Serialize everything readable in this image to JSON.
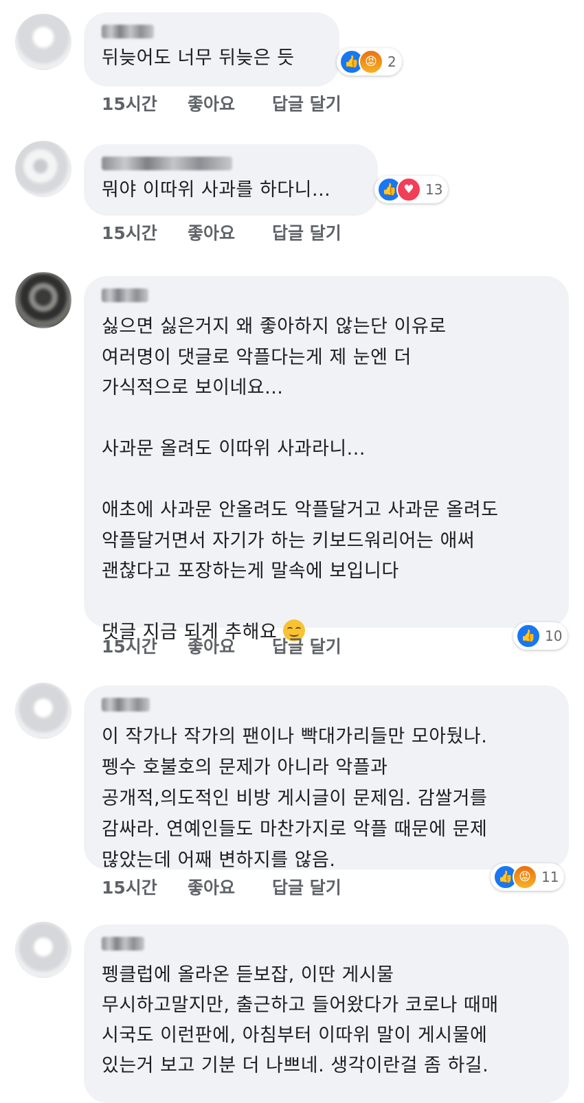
{
  "comments": [
    {
      "text": "뒤늦어도 너무 뒤늦은 듯",
      "meta": {
        "time": "15시간",
        "like": "좋아요",
        "reply": "답글 달기"
      },
      "reactions": {
        "icons": [
          "like",
          "angry"
        ],
        "count": "2"
      }
    },
    {
      "text": "뭐야 이따위 사과를 하다니...",
      "meta": {
        "time": "15시간",
        "like": "좋아요",
        "reply": "답글 달기"
      },
      "reactions": {
        "icons": [
          "like",
          "love"
        ],
        "count": "13"
      }
    },
    {
      "lines": [
        "싫으면 싫은거지 왜 좋아하지 않는단 이유로",
        "여러명이 댓글로 악플다는게 제 눈엔 더",
        "가식적으로 보이네요...",
        "",
        "사과문 올려도 이따위 사과라니...",
        "",
        "애초에 사과문 안올려도 악플달거고 사과문 올려도",
        "악플달거면서 자기가 하는 키보드워리어는 애써",
        "괜찮다고 포장하는게 말속에 보입니다",
        "",
        "댓글 지금 되게 추해요"
      ],
      "meta": {
        "time": "15시간",
        "like": "좋아요",
        "reply": "답글 달기"
      },
      "reactions": {
        "icons": [
          "like"
        ],
        "count": "10"
      }
    },
    {
      "lines": [
        "이 작가나 작가의 팬이나 빡대가리들만 모아뒀나.",
        "펭수 호불호의 문제가 아니라 악플과",
        "공개적,의도적인 비방 게시글이 문제임. 감쌀거를",
        "감싸라. 연예인들도 마찬가지로 악플 때문에 문제",
        "많았는데 어째 변하지를 않음."
      ],
      "meta": {
        "time": "15시간",
        "like": "좋아요",
        "reply": "답글 달기"
      },
      "reactions": {
        "icons": [
          "like",
          "angry"
        ],
        "count": "11"
      }
    },
    {
      "lines": [
        "펭클럽에 올라온 듣보잡, 이딴 게시물",
        "무시하고말지만, 출근하고 들어왔다가 코로나 때매",
        "시국도 이런판에, 아침부터 이따위 말이 게시물에",
        "있는거 보고 기분 더 나쁘네. 생각이란걸 좀 하길."
      ]
    }
  ]
}
